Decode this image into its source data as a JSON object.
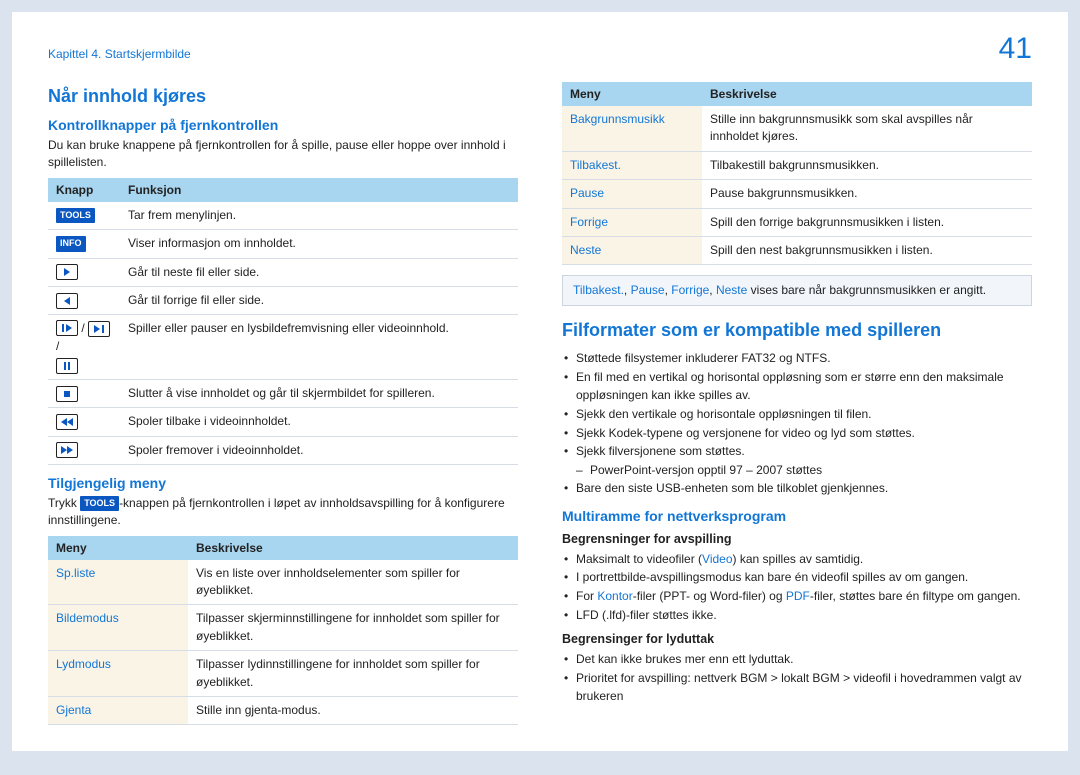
{
  "header": {
    "chapter": "Kapittel 4. Startskjermbilde",
    "page_number": "41"
  },
  "left": {
    "h2_playing": "Når innhold kjøres",
    "h3_remote": "Kontrollknapper på fjernkontrollen",
    "p_remote": "Du kan bruke knappene på fjernkontrollen for å spille, pause eller hoppe over innhold i spillelisten.",
    "table_knapp": {
      "th_knapp": "Knapp",
      "th_funksjon": "Funksjon",
      "rows": [
        {
          "btn_label": "TOOLS",
          "desc": "Tar frem menylinjen."
        },
        {
          "btn_label": "INFO",
          "desc": "Viser informasjon om innholdet."
        },
        {
          "icon": "play",
          "desc": "Går til neste fil eller side."
        },
        {
          "icon": "prev",
          "desc": "Går til forrige fil eller side."
        },
        {
          "icon": "playpause",
          "desc": "Spiller eller pauser en lysbildefremvisning eller videoinnhold."
        },
        {
          "icon": "stop",
          "desc": "Slutter å vise innholdet og går til skjermbildet for spilleren."
        },
        {
          "icon": "rew",
          "desc": "Spoler tilbake i videoinnholdet."
        },
        {
          "icon": "fwd",
          "desc": "Spoler fremover i videoinnholdet."
        }
      ]
    },
    "h3_menu": "Tilgjengelig meny",
    "p_menu_1": "Trykk ",
    "p_menu_badge": "TOOLS",
    "p_menu_2": "-knappen på fjernkontrollen i løpet av innholdsavspilling for å konfigurere innstillingene.",
    "table_meny": {
      "th_meny": "Meny",
      "th_besk": "Beskrivelse",
      "rows": [
        {
          "name": "Sp.liste",
          "desc": "Vis en liste over innholdselementer som spiller for øyeblikket."
        },
        {
          "name": "Bildemodus",
          "desc": "Tilpasser skjerminnstillingene for innholdet som spiller for øyeblikket."
        },
        {
          "name": "Lydmodus",
          "desc": "Tilpasser lydinnstillingene for innholdet som spiller for øyeblikket."
        },
        {
          "name": "Gjenta",
          "desc": "Stille inn gjenta-modus."
        }
      ]
    }
  },
  "right": {
    "table_meny2": {
      "th_meny": "Meny",
      "th_besk": "Beskrivelse",
      "rows": [
        {
          "name": "Bakgrunnsmusikk",
          "desc": "Stille inn bakgrunnsmusikk som skal avspilles når innholdet kjøres."
        },
        {
          "name": "Tilbakest.",
          "desc": "Tilbakestill bakgrunnsmusikken."
        },
        {
          "name": "Pause",
          "desc": "Pause bakgrunnsmusikken."
        },
        {
          "name": "Forrige",
          "desc": "Spill den forrige bakgrunnsmusikken i listen."
        },
        {
          "name": "Neste",
          "desc": "Spill den nest bakgrunnsmusikken i listen."
        }
      ]
    },
    "note": {
      "m1": "Tilbakest.",
      "m2": "Pause",
      "m3": "Forrige",
      "m4": "Neste",
      "text": " vises bare når bakgrunnsmusikken er angitt."
    },
    "h2_formats": "Filformater som er kompatible med spilleren",
    "bullets_formats": [
      "Støttede filsystemer inkluderer FAT32 og NTFS.",
      "En fil med en vertikal og horisontal oppløsning som er større enn den maksimale oppløsningen kan ikke spilles av.",
      "Sjekk den vertikale og horisontale oppløsningen til filen.",
      "Sjekk Kodek-typene og versjonene for video og lyd som støttes.",
      "Sjekk filversjonene som støttes.",
      "PowerPoint-versjon opptil 97 – 2007 støttes",
      "Bare den siste USB-enheten som ble tilkoblet gjenkjennes."
    ],
    "h3_multiframe": "Multiramme for nettverksprogram",
    "h4_playlimits": "Begrensninger for avspilling",
    "play_limits": {
      "l1a": "Maksimalt to videofiler (",
      "l1b": "Video",
      "l1c": ") kan spilles av samtidig.",
      "l2": "I portrettbilde-avspillingsmodus kan bare én videofil spilles av om gangen.",
      "l3a": "For ",
      "l3b": "Kontor",
      "l3c": "-filer (PPT- og Word-filer) og ",
      "l3d": "PDF",
      "l3e": "-filer, støttes bare én filtype om gangen.",
      "l4": "LFD (.lfd)-filer støttes ikke."
    },
    "h4_soundlimits": "Begrensinger for lyduttak",
    "sound_limits": [
      "Det kan ikke brukes mer enn ett lyduttak.",
      "Prioritet for avspilling: nettverk BGM > lokalt BGM > videofil i hovedrammen valgt av brukeren"
    ]
  }
}
